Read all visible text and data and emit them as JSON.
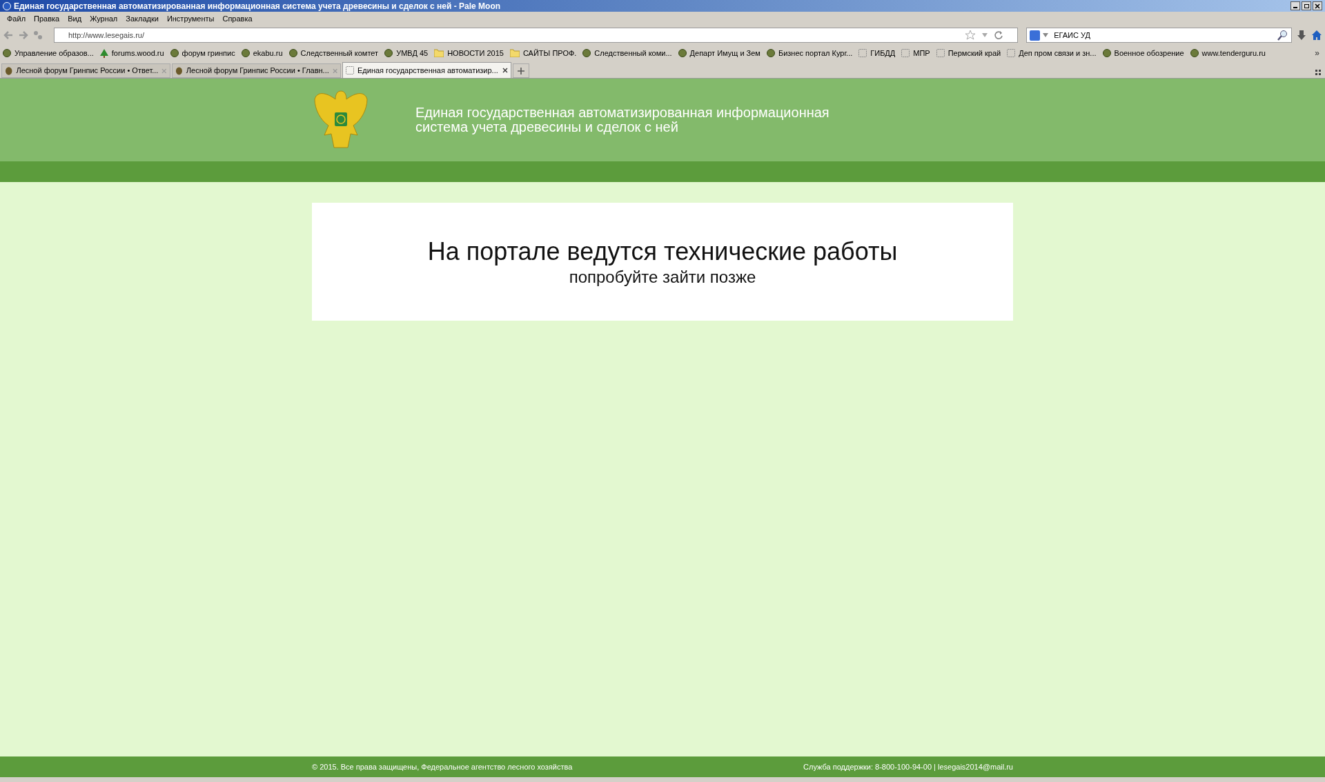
{
  "window": {
    "title": "Единая государственная автоматизированная информационная система учета древесины и сделок с ней - Pale Moon"
  },
  "menu": [
    "Файл",
    "Правка",
    "Вид",
    "Журнал",
    "Закладки",
    "Инструменты",
    "Справка"
  ],
  "address_bar": {
    "value": "http://www.lesegais.ru/"
  },
  "search": {
    "value": "ЕГАИС УД"
  },
  "bookmarks": [
    {
      "label": "Управление образов...",
      "kind": "site"
    },
    {
      "label": "forums.wood.ru",
      "kind": "tree"
    },
    {
      "label": "форум гринпис",
      "kind": "site"
    },
    {
      "label": "ekabu.ru",
      "kind": "site"
    },
    {
      "label": "Следственный комтет",
      "kind": "site"
    },
    {
      "label": "УМВД 45",
      "kind": "site"
    },
    {
      "label": "НОВОСТИ 2015",
      "kind": "folder"
    },
    {
      "label": "САЙТЫ ПРОФ.",
      "kind": "folder"
    },
    {
      "label": "Следственный коми...",
      "kind": "site"
    },
    {
      "label": "Департ Имущ и Зем",
      "kind": "site"
    },
    {
      "label": "Бизнес портал Кург...",
      "kind": "site"
    },
    {
      "label": "ГИБДД",
      "kind": "page"
    },
    {
      "label": "МПР",
      "kind": "page"
    },
    {
      "label": "Пермский край",
      "kind": "page"
    },
    {
      "label": "Деп пром связи и зн...",
      "kind": "page"
    },
    {
      "label": "Военное обозрение",
      "kind": "site"
    },
    {
      "label": "www.tenderguru.ru",
      "kind": "site"
    }
  ],
  "bookmarks_overflow": "»",
  "tabs": [
    {
      "label": "Лесной форум Гринпис России • Ответ...",
      "selected": false
    },
    {
      "label": "Лесной форум Гринпис России • Главн...",
      "selected": false
    },
    {
      "label": "Единая государственная автоматизир...",
      "selected": true
    }
  ],
  "header": {
    "title_lines": [
      "Единая государственная автоматизированная информационная",
      "система учета древесины и сделок с ней"
    ]
  },
  "notice": {
    "heading": "На портале ведутся технические работы",
    "subheading": "попробуйте зайти позже"
  },
  "footer": {
    "copyright": "© 2015. Все права защищены, Федеральное агентство лесного хозяйства",
    "support": "Служба поддержки: 8-800-100-94-00 | lesegais2014@mail.ru"
  }
}
